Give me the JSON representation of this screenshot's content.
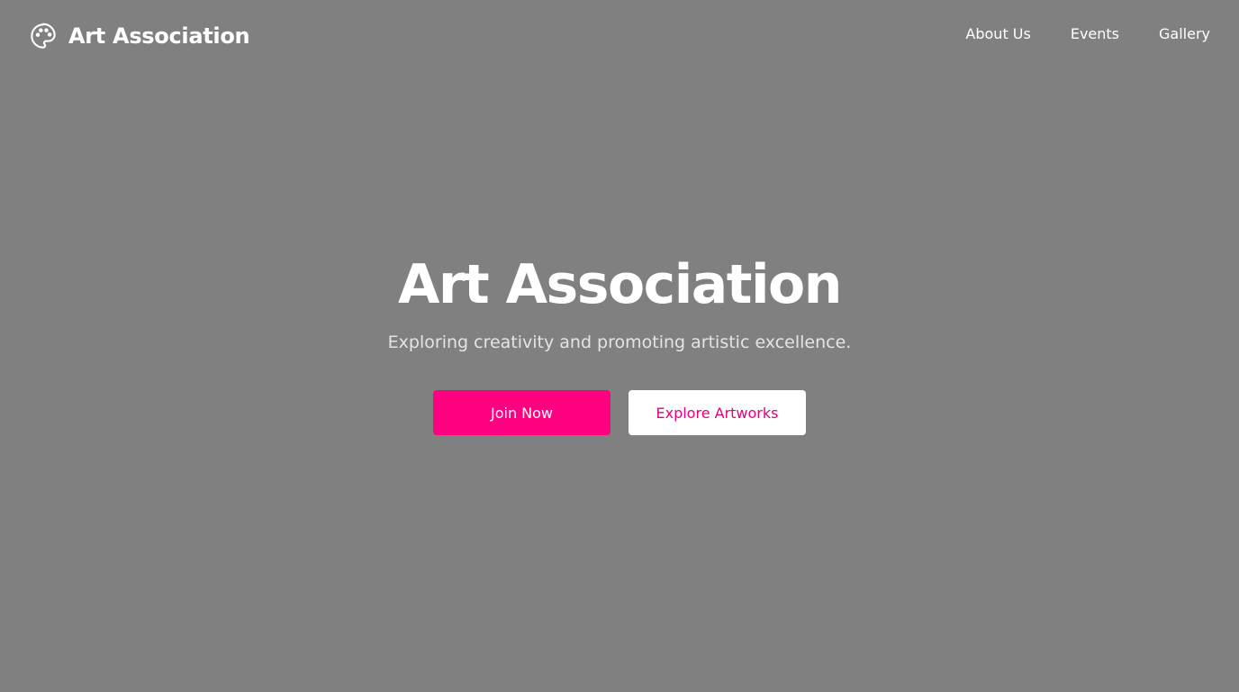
{
  "header": {
    "brand_name": "Art Association",
    "brand_icon": "palette-icon",
    "nav": [
      {
        "label": "About Us"
      },
      {
        "label": "Events"
      },
      {
        "label": "Gallery"
      }
    ]
  },
  "hero": {
    "title": "Art Association",
    "subtitle": "Exploring creativity and promoting artistic excellence.",
    "primary_button": "Join Now",
    "secondary_button": "Explore Artworks"
  },
  "colors": {
    "background": "#808080",
    "accent": "#ff0080",
    "text": "#ffffff"
  }
}
